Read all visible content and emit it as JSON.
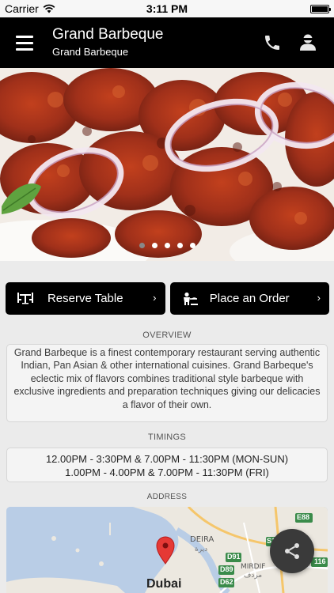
{
  "status_bar": {
    "carrier": "Carrier",
    "time": "3:11 PM"
  },
  "header": {
    "title": "Grand Barbeque",
    "subtitle": "Grand Barbeque"
  },
  "carousel": {
    "total_slides": 5,
    "active_index": 0
  },
  "actions": {
    "reserve_label": "Reserve Table",
    "order_label": "Place an Order",
    "chevron": "›"
  },
  "overview": {
    "label": "OVERVIEW",
    "text": "Grand Barbeque is a finest contemporary restaurant serving authentic Indian, Pan Asian & other international cuisines. Grand Barbeque's eclectic mix of flavors combines traditional style barbeque with exclusive ingredients and preparation techniques giving our delicacies a flavor of their own."
  },
  "timings": {
    "label": "TIMINGS",
    "line1": "12.00PM - 3:30PM & 7.00PM - 11:30PM (MON-SUN)",
    "line2": "1.00PM - 4.00PM & 7.00PM - 11:30PM (FRI)"
  },
  "address": {
    "label": "ADDRESS",
    "map_labels": {
      "city": "Dubai",
      "deira": "DEIRA",
      "deira_ar": "ديرة",
      "mirdif": "MIRDIF",
      "mirdif_ar": "مردف",
      "e88": "E88",
      "d91": "D91",
      "d89": "D89",
      "d62": "D62",
      "e116": "116",
      "s1": "S1"
    }
  },
  "icons": {
    "menu": "hamburger-icon",
    "phone": "phone-icon",
    "user": "user-icon",
    "share": "share-icon",
    "map_pin": "map-pin-icon"
  },
  "colors": {
    "header_bg": "#000000",
    "button_bg": "#000000",
    "page_bg": "#ebebeb",
    "pin": "#e53935"
  }
}
